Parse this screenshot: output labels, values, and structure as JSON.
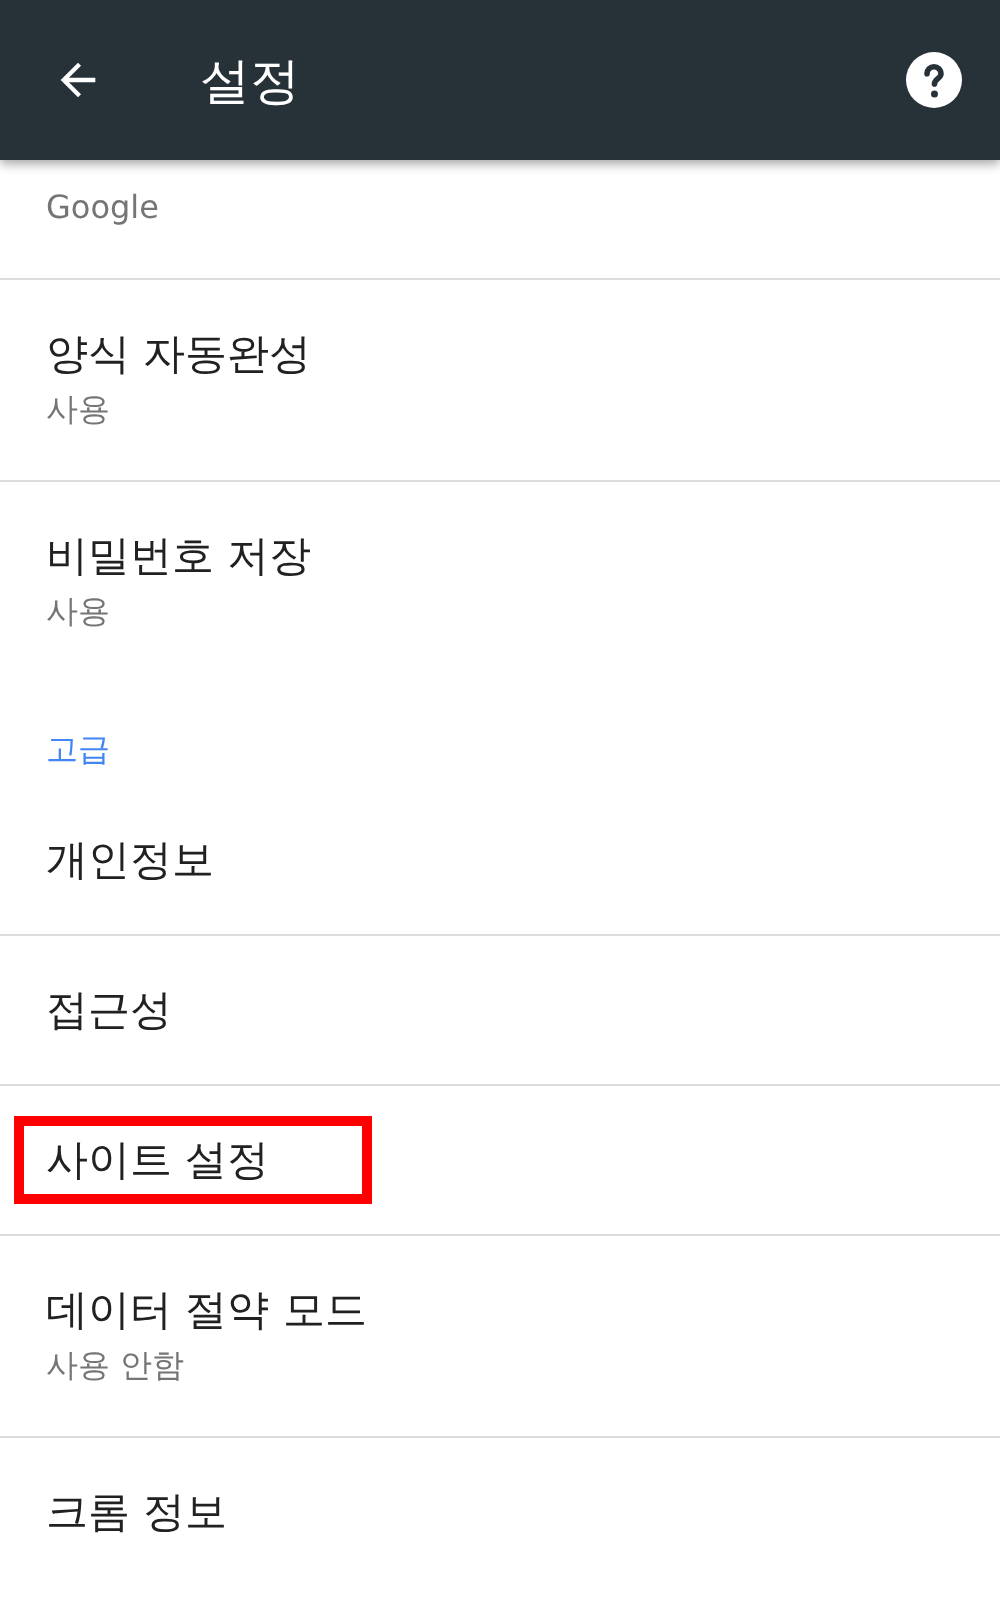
{
  "header": {
    "title": "설정"
  },
  "items": [
    {
      "kind": "item",
      "subtitle": "Google",
      "highlighted": false
    },
    {
      "kind": "item",
      "title": "양식 자동완성",
      "subtitle": "사용",
      "highlighted": false
    },
    {
      "kind": "item",
      "title": "비밀번호 저장",
      "subtitle": "사용",
      "highlighted": false
    },
    {
      "kind": "section",
      "title": "고급"
    },
    {
      "kind": "item",
      "title": "개인정보",
      "highlighted": false
    },
    {
      "kind": "item",
      "title": "접근성",
      "highlighted": false
    },
    {
      "kind": "item",
      "title": "사이트 설정",
      "highlighted": true
    },
    {
      "kind": "item",
      "title": "데이터 절약 모드",
      "subtitle": "사용 안함",
      "highlighted": false
    },
    {
      "kind": "item",
      "title": "크롬 정보",
      "highlighted": false
    }
  ]
}
